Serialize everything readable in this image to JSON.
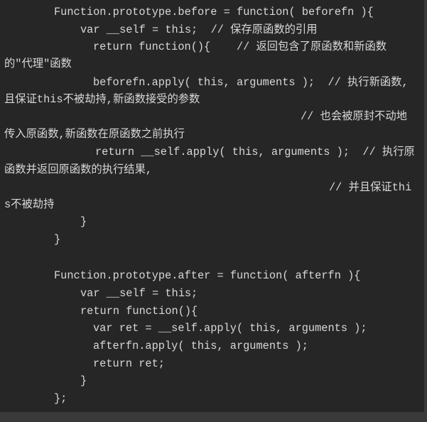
{
  "code": {
    "lines": [
      "Function.prototype.before = function( beforefn ){",
      "var __self = this;  // 保存原函数的引用",
      "return function(){    // 返回包含了原函数和新函数",
      "的\"代理\"函数",
      "beforefn.apply( this, arguments );  // 执行新函数,",
      "且保证this不被劫持,新函数接受的参数",
      "// 也会被原封不动地",
      "传入原函数,新函数在原函数之前执行",
      "return __self.apply( this, arguments );  // 执行原",
      "函数并返回原函数的执行结果,",
      "// 并且保证thi",
      "s不被劫持",
      "}",
      "}",
      "Function.prototype.after = function( afterfn ){",
      "var __self = this;",
      "return function(){",
      "var ret = __self.apply( this, arguments );",
      "afterfn.apply( this, arguments );",
      "return ret;",
      "}",
      "};"
    ]
  }
}
